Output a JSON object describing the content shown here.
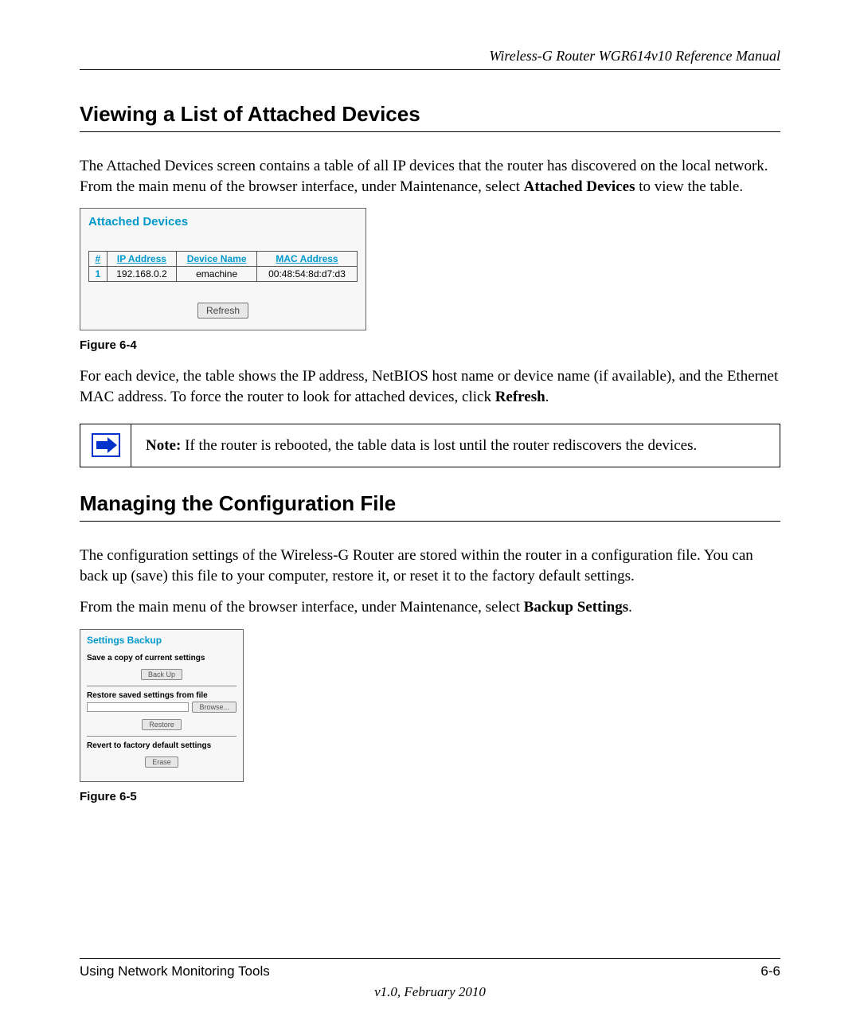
{
  "header": {
    "title": "Wireless-G Router WGR614v10 Reference Manual"
  },
  "section1": {
    "heading": "Viewing a List of Attached Devices",
    "para1_pre": "The Attached Devices screen contains a table of all IP devices that the router has discovered on the local network. From the main menu of the browser interface, under Maintenance, select ",
    "para1_bold": "Attached Devices",
    "para1_post": " to view the table.",
    "fig_caption": "Figure 6-4",
    "para2_pre": "For each device, the table shows the IP address, NetBIOS host name or device name (if available), and the Ethernet MAC address. To force the router to look for attached devices, click ",
    "para2_bold": "Refresh",
    "para2_post": "."
  },
  "attached_devices": {
    "title": "Attached Devices",
    "columns": {
      "num": "#",
      "ip": "IP Address",
      "name": "Device Name",
      "mac": "MAC Address"
    },
    "rows": [
      {
        "num": "1",
        "ip": "192.168.0.2",
        "name": "emachine",
        "mac": "00:48:54:8d:d7:d3"
      }
    ],
    "refresh_label": "Refresh"
  },
  "note": {
    "label": "Note:",
    "text": " If the router is rebooted, the table data is lost until the router rediscovers the devices."
  },
  "section2": {
    "heading": "Managing the Configuration File",
    "para1": "The configuration settings of the Wireless-G Router are stored within the router in a configuration file. You can back up (save) this file to your computer, restore it, or reset it to the factory default settings.",
    "para2_pre": "From the main menu of the browser interface, under Maintenance, select ",
    "para2_bold": "Backup Settings",
    "para2_post": ".",
    "fig_caption": "Figure 6-5"
  },
  "settings_backup": {
    "title": "Settings Backup",
    "save_label": "Save a copy of current settings",
    "backup_btn": "Back Up",
    "restore_label": "Restore saved settings from file",
    "browse_btn": "Browse...",
    "restore_btn": "Restore",
    "revert_label": "Revert to factory default settings",
    "erase_btn": "Erase"
  },
  "footer": {
    "left": "Using Network Monitoring Tools",
    "right": "6-6",
    "center": "v1.0, February 2010"
  }
}
